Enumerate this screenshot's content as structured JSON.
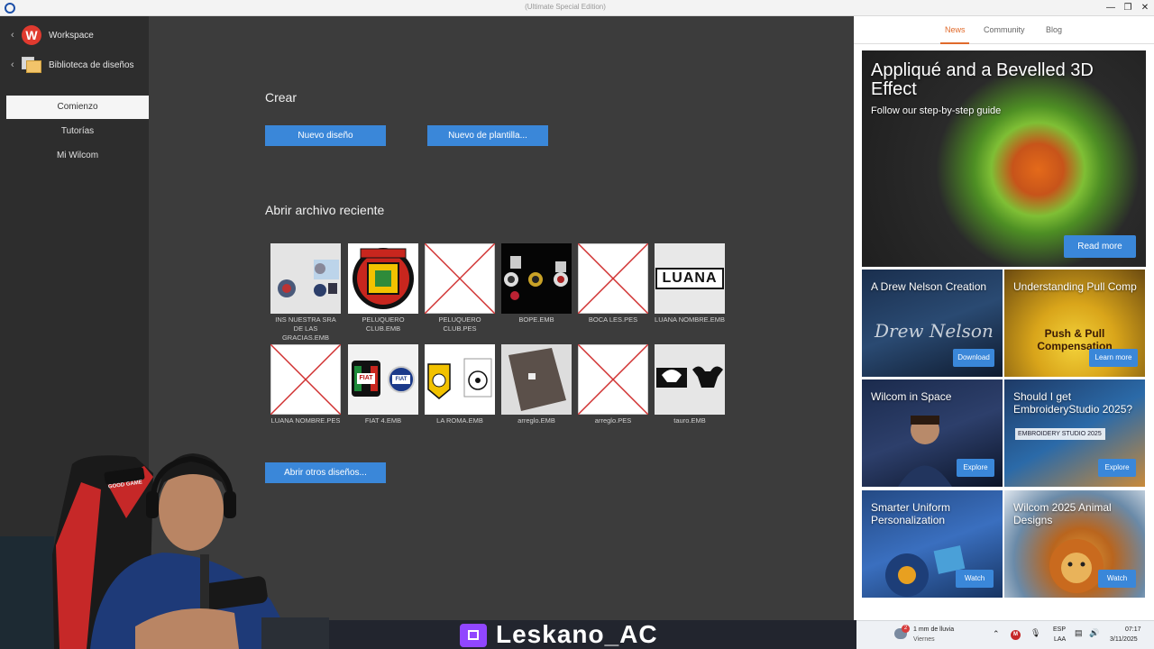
{
  "window": {
    "title": "(Ultimate Special Edition)",
    "controls": [
      "minimize",
      "restore",
      "close"
    ]
  },
  "sidebar": {
    "links": [
      {
        "label": "Workspace",
        "icon": "wilcom-logo-icon"
      },
      {
        "label": "Biblioteca de diseños",
        "icon": "folder-icon"
      }
    ],
    "nav": [
      {
        "label": "Comienzo",
        "active": true
      },
      {
        "label": "Tutorías",
        "active": false
      },
      {
        "label": "Mi Wilcom",
        "active": false
      }
    ]
  },
  "main": {
    "create_title": "Crear",
    "new_design_button": "Nuevo diseño",
    "new_template_button": "Nuevo de plantilla...",
    "recent_title": "Abrir archivo reciente",
    "open_other_button": "Abrir otros diseños...",
    "recent_files": [
      {
        "name": "INS NUESTRA SRA DE LAS GRACIAS.EMB",
        "preview": "image"
      },
      {
        "name": "PELUQUERO CLUB.EMB",
        "preview": "image"
      },
      {
        "name": "PELUQUERO CLUB.PES",
        "preview": "none"
      },
      {
        "name": "BOPE.EMB",
        "preview": "image"
      },
      {
        "name": "BOCA LES.PES",
        "preview": "none"
      },
      {
        "name": "LUANA NOMBRE.EMB",
        "preview": "image"
      },
      {
        "name": "LUANA NOMBRE.PES",
        "preview": "none"
      },
      {
        "name": "FIAT 4.EMB",
        "preview": "image"
      },
      {
        "name": "LA ROMA.EMB",
        "preview": "image"
      },
      {
        "name": "arreglo.EMB",
        "preview": "image"
      },
      {
        "name": "arreglo.PES",
        "preview": "none"
      },
      {
        "name": "tauro.EMB",
        "preview": "image"
      }
    ],
    "thumb_text": {
      "luana": "LUANA",
      "fiat": "FIAT"
    }
  },
  "right_panel": {
    "tabs": [
      {
        "label": "News",
        "active": true
      },
      {
        "label": "Community",
        "active": false
      },
      {
        "label": "Blog",
        "active": false
      }
    ],
    "hero": {
      "title": "Appliqué and a Bevelled 3D Effect",
      "subtitle": "Follow our step-by-step guide",
      "button": "Read more"
    },
    "cards": [
      {
        "title": "A Drew Nelson Creation",
        "button": "Download",
        "art_text": "Drew Nelson"
      },
      {
        "title": "Understanding Pull Comp",
        "button": "Learn more",
        "art_text": "Push & Pull Compensation"
      },
      {
        "title": "Wilcom in Space",
        "button": "Explore"
      },
      {
        "title": "Should I get EmbroideryStudio 2025?",
        "button": "Explore",
        "art_text": "EMBROIDERY STUDIO 2025"
      },
      {
        "title": "Smarter Uniform Personalization",
        "button": "Watch"
      },
      {
        "title": "Wilcom 2025 Animal Designs",
        "button": "Watch"
      }
    ]
  },
  "stream": {
    "handle": "Leskano_AC",
    "chair_text": "GOOD GAME"
  },
  "taskbar": {
    "weather_badge": "2",
    "weather": "1 mm de lluvia",
    "weather_day": "Viernes",
    "language": "ESP",
    "language_sub": "LAA",
    "time": "07:17",
    "date": "3/11/2025",
    "notification_badge": "M"
  },
  "colors": {
    "accent_blue": "#3a87d9",
    "tab_orange": "#e06a2b",
    "sidebar": "#2d2d2d",
    "main_bg": "#3c3c3c",
    "twitch": "#9146ff"
  }
}
